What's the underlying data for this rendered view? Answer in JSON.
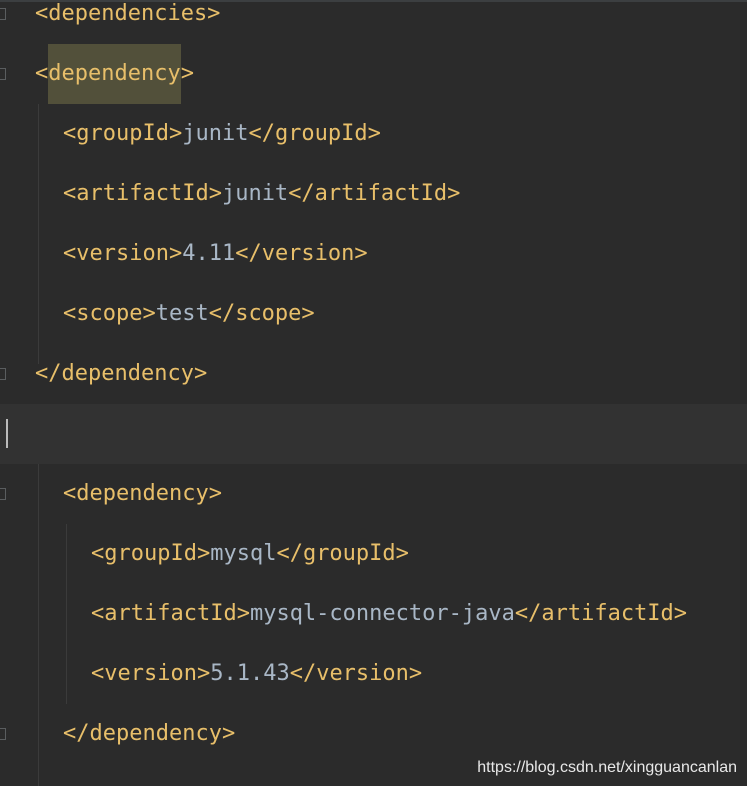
{
  "colors": {
    "background": "#2b2b2b",
    "current_line": "#323232",
    "tag": "#e8bf6a",
    "text": "#a9b7c6",
    "match_highlight": "#52503a"
  },
  "lines": {
    "l1": {
      "tag": "<dependencies>"
    },
    "l2": {
      "tag_open": "<",
      "tag_name": "dependency",
      "tag_close": ">"
    },
    "l3": {
      "open": "<groupId>",
      "value": "junit",
      "close": "</groupId>"
    },
    "l4": {
      "open": "<artifactId>",
      "value": "junit",
      "close": "</artifactId>"
    },
    "l5": {
      "open": "<version>",
      "value": "4.11",
      "close": "</version>"
    },
    "l6": {
      "open": "<scope>",
      "value": "test",
      "close": "</scope>"
    },
    "l7": {
      "tag": "</dependency>"
    },
    "l8": {
      "tag": ""
    },
    "l9": {
      "tag": "<dependency>"
    },
    "l10": {
      "open": "<groupId>",
      "value": "mysql",
      "close": "</groupId>"
    },
    "l11": {
      "open": "<artifactId>",
      "value": "mysql-connector-java",
      "close": "</artifactId>"
    },
    "l12": {
      "open": "<version>",
      "value": "5.1.43",
      "close": "</version>"
    },
    "l13": {
      "tag": "</dependency>"
    }
  },
  "watermark": "https://blog.csdn.net/xingguancanlan"
}
